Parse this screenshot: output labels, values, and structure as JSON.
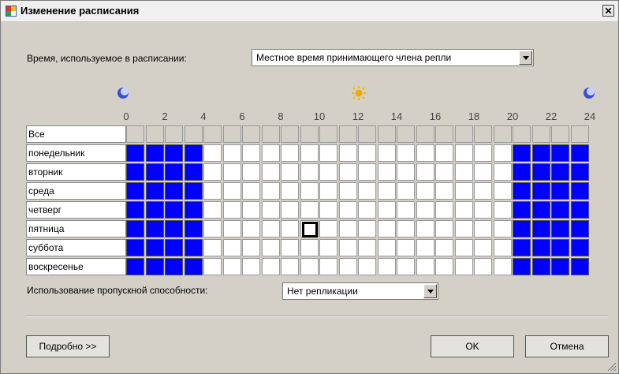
{
  "window": {
    "title": "Изменение расписания",
    "close_label": "✕"
  },
  "time": {
    "label": "Время, используемое в расписании:",
    "value": "Местное время принимающего члена репли"
  },
  "schedule": {
    "hour_labels": [
      "0",
      "2",
      "4",
      "6",
      "8",
      "10",
      "12",
      "14",
      "16",
      "18",
      "20",
      "22",
      "24"
    ],
    "header_row": "Все",
    "days": [
      "понедельник",
      "вторник",
      "среда",
      "четверг",
      "пятница",
      "суббота",
      "воскресенье"
    ],
    "on_hours": [
      0,
      1,
      2,
      3,
      20,
      21,
      22,
      23
    ],
    "focused_cell": {
      "day": "пятница",
      "hour": 9
    }
  },
  "bandwidth": {
    "label": "Использование пропускной способности:",
    "value": "Нет репликации"
  },
  "buttons": {
    "details": "Подробно >>",
    "ok": "OK",
    "cancel": "Отмена"
  },
  "icons": {
    "night": "moon-icon",
    "day": "sun-icon"
  },
  "colors": {
    "active": "#0000ff",
    "inactive": "#ffffff"
  }
}
